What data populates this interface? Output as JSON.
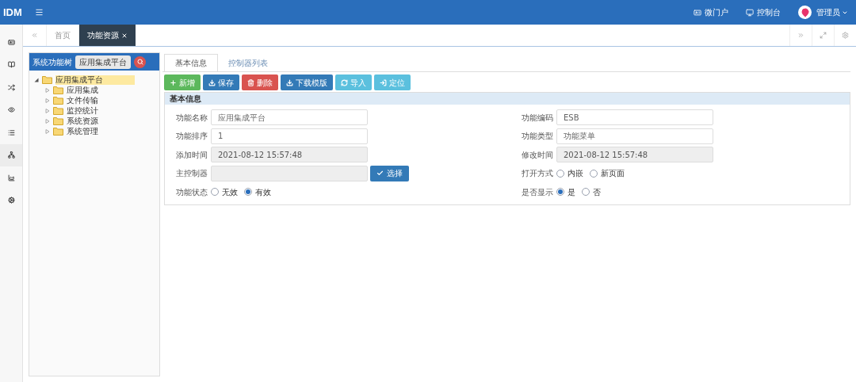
{
  "header": {
    "logo": "IDM",
    "links": [
      {
        "kind": "portal",
        "label": "微门户"
      },
      {
        "kind": "console",
        "label": "控制台"
      }
    ],
    "user": "管理员"
  },
  "page_tabs": [
    {
      "label": "首页",
      "selected": false
    },
    {
      "label": "功能资源",
      "selected": true
    }
  ],
  "tree_panel": {
    "title": "系统功能树",
    "search_value": "应用集成平台",
    "tree": [
      {
        "label": "应用集成平台",
        "expanded": true,
        "selected": true,
        "children": [
          {
            "label": "应用集成",
            "expanded": false,
            "selected": false
          },
          {
            "label": "文件传输",
            "expanded": false,
            "selected": false
          },
          {
            "label": "监控统计",
            "expanded": false,
            "selected": false
          },
          {
            "label": "系统资源",
            "expanded": false,
            "selected": false
          },
          {
            "label": "系统管理",
            "expanded": false,
            "selected": false
          }
        ]
      }
    ]
  },
  "content_tabs": [
    {
      "label": "基本信息",
      "selected": true
    },
    {
      "label": "控制器列表",
      "selected": false
    }
  ],
  "toolbar": [
    {
      "kind": "add",
      "label": "新增",
      "color": "#5cb85c"
    },
    {
      "kind": "download",
      "label": "保存",
      "color": "#337ab7"
    },
    {
      "kind": "delete",
      "label": "删除",
      "color": "#d9534f"
    },
    {
      "kind": "download",
      "label": "下载模版",
      "color": "#337ab7"
    },
    {
      "kind": "import",
      "label": "导入",
      "color": "#5bc0de"
    },
    {
      "kind": "locate",
      "label": "定位",
      "color": "#5bc0de"
    }
  ],
  "section_title": "基本信息",
  "form_rows": [
    [
      {
        "kind": "text",
        "label": "功能名称",
        "value": "应用集成平台"
      },
      {
        "kind": "text",
        "label": "功能编码",
        "value": "ESB"
      }
    ],
    [
      {
        "kind": "text",
        "label": "功能排序",
        "value": "1"
      },
      {
        "kind": "text",
        "label": "功能类型",
        "value": "功能菜单"
      }
    ],
    [
      {
        "kind": "readonly",
        "label": "添加时间",
        "value": "2021-08-12 15:57:48"
      },
      {
        "kind": "readonly",
        "label": "修改时间",
        "value": "2021-08-12 15:57:48"
      }
    ],
    [
      {
        "kind": "picker",
        "label": "主控制器",
        "button": "选择"
      },
      {
        "kind": "radio",
        "label": "打开方式",
        "options": [
          {
            "label": "内嵌",
            "selected": false
          },
          {
            "label": "新页面",
            "selected": false
          }
        ]
      }
    ],
    [
      {
        "kind": "radio",
        "label": "功能状态",
        "options": [
          {
            "label": "无效",
            "selected": false
          },
          {
            "label": "有效",
            "selected": true
          }
        ]
      },
      {
        "kind": "radio",
        "label": "是否显示",
        "options": [
          {
            "label": "是",
            "selected": true
          },
          {
            "label": "否",
            "selected": false
          }
        ]
      }
    ]
  ]
}
